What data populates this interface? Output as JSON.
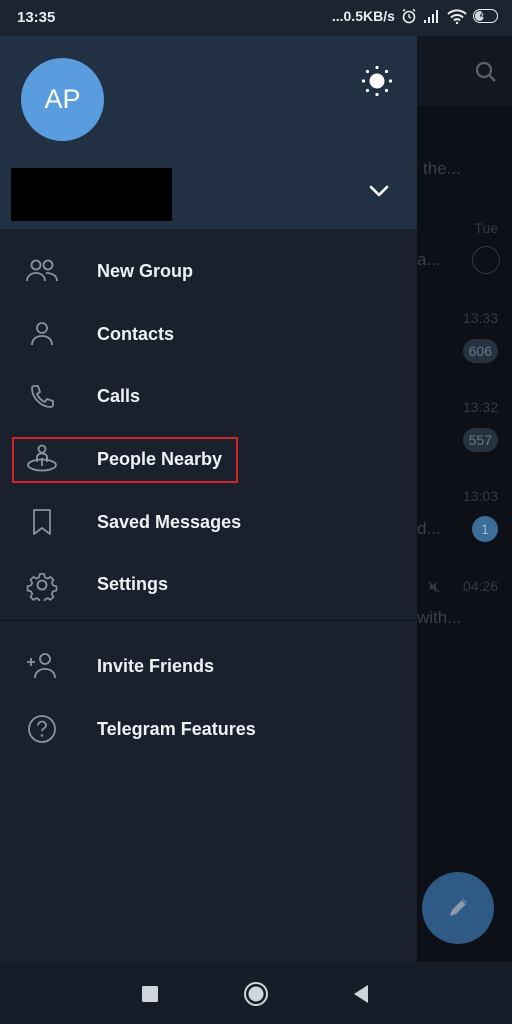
{
  "status_bar": {
    "time": "13:35",
    "network_speed": "...0.5KB/s",
    "icons": [
      "alarm-icon",
      "signal-icon",
      "wifi-icon"
    ],
    "battery": "47",
    "battery_level_percent": 47
  },
  "drawer": {
    "avatar_initials": "AP",
    "theme_toggle_icon": "sun-icon",
    "account_expand_icon": "chevron-down-icon",
    "menu_items": [
      {
        "label": "New Group",
        "icon": "group-icon"
      },
      {
        "label": "Contacts",
        "icon": "contact-icon"
      },
      {
        "label": "Calls",
        "icon": "phone-icon"
      },
      {
        "label": "People Nearby",
        "icon": "people-nearby-icon",
        "highlighted": true
      },
      {
        "label": "Saved Messages",
        "icon": "bookmark-icon"
      },
      {
        "label": "Settings",
        "icon": "gear-icon"
      }
    ],
    "secondary_items": [
      {
        "label": "Invite Friends",
        "icon": "add-user-icon"
      },
      {
        "label": "Telegram Features",
        "icon": "help-icon"
      }
    ],
    "highlight_color": "#d3232f"
  },
  "background_chats": {
    "snippets": [
      "the...",
      "a...",
      "...",
      "d...",
      "with..."
    ],
    "times": [
      "Tue",
      "13:33",
      "13:32",
      "13:03",
      "04:26"
    ],
    "badges": [
      "606",
      "557",
      "1"
    ]
  },
  "nav_bar": {
    "buttons": [
      "recents",
      "home",
      "back"
    ]
  }
}
